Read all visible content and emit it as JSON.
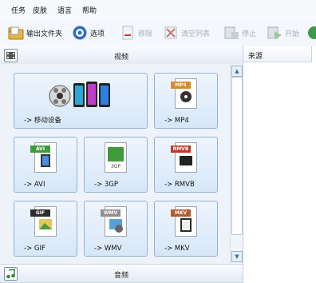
{
  "menu": [
    "任务",
    "皮肤",
    "语言",
    "帮助"
  ],
  "toolbar": {
    "output_folder": "输出文件夹",
    "options": "选项",
    "remove": "移除",
    "clear_list": "清空列表",
    "stop": "停止",
    "start": "开始"
  },
  "video_section": {
    "title": "视频"
  },
  "audio_section": {
    "title": "音频"
  },
  "tiles": [
    {
      "label": "-> 移动设备",
      "tag": ""
    },
    {
      "label": "-> MP4",
      "tag": "MP4"
    },
    {
      "label": "-> AVI",
      "tag": "AVI"
    },
    {
      "label": "-> 3GP",
      "tag": "3GP"
    },
    {
      "label": "-> RMVB",
      "tag": "RMVB"
    },
    {
      "label": "-> GIF",
      "tag": "GIF"
    },
    {
      "label": "-> WMV",
      "tag": "WMV"
    },
    {
      "label": "-> MKV",
      "tag": "MKV"
    }
  ],
  "file_list": {
    "source_header": "来源"
  },
  "colors": {
    "accent": "#2f6fc0",
    "tile_border": "#91b3d9",
    "mp4": "#d98a2b",
    "avi": "#3f9a3a",
    "gif": "#2c2c2c",
    "wmv": "#8f8f8f",
    "rmvb": "#c0392b",
    "mkv": "#b35a30"
  }
}
